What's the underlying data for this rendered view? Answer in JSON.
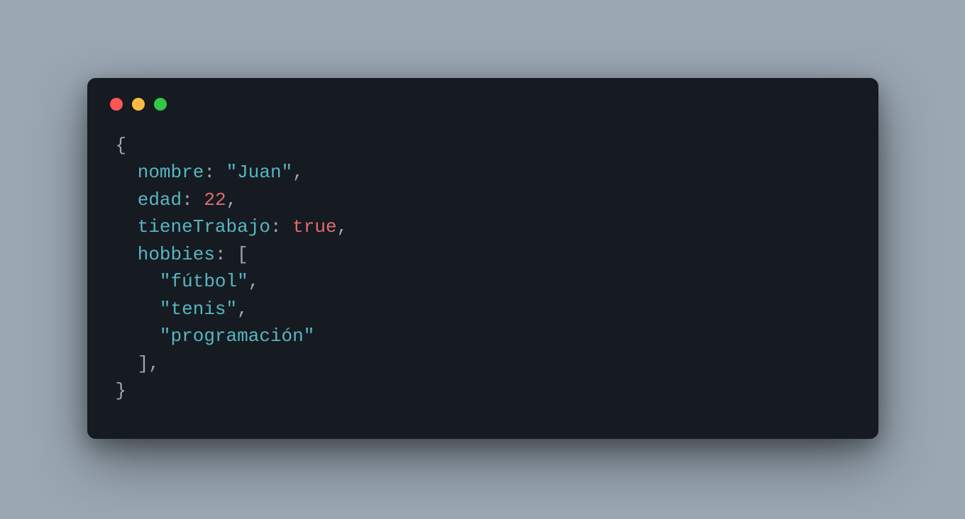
{
  "code": {
    "key_nombre": "nombre",
    "val_nombre": "\"Juan\"",
    "key_edad": "edad",
    "val_edad": "22",
    "key_tieneTrabajo": "tieneTrabajo",
    "val_tieneTrabajo": "true",
    "key_hobbies": "hobbies",
    "hobby0": "\"fútbol\"",
    "hobby1": "\"tenis\"",
    "hobby2": "\"programación\""
  }
}
